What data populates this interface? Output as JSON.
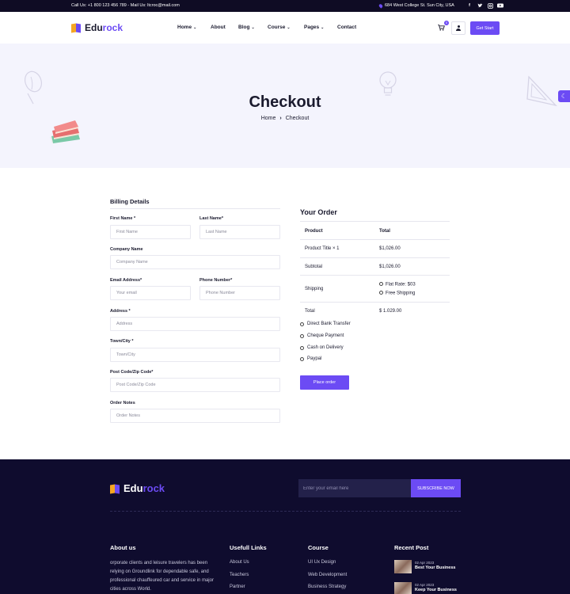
{
  "topbar": {
    "contact": "Call Us: +1 800 123 456 789 - Mail Us: ltcroc@mail.com",
    "address": "684 West College St. Sun City, USA",
    "socials": [
      "facebook-icon",
      "twitter-icon",
      "instagram-icon",
      "youtube-icon"
    ]
  },
  "header": {
    "logo_prefix": "Edu",
    "logo_suffix": "rock",
    "nav": [
      {
        "label": "Home",
        "dropdown": true
      },
      {
        "label": "About",
        "dropdown": false
      },
      {
        "label": "Blog",
        "dropdown": true
      },
      {
        "label": "Course",
        "dropdown": true
      },
      {
        "label": "Pages",
        "dropdown": true
      },
      {
        "label": "Contact",
        "dropdown": false
      }
    ],
    "cart_count": "0",
    "cta_label": "Get Start"
  },
  "hero": {
    "title": "Checkout",
    "breadcrumb_home": "Home",
    "breadcrumb_current": "Checkout"
  },
  "billing": {
    "title": "Billing Details",
    "first_name_label": "First Name *",
    "first_name_placeholder": "First Name",
    "last_name_label": "Last Name*",
    "last_name_placeholder": "Last Name",
    "company_label": "Company Name",
    "company_placeholder": "Company Name",
    "email_label": "Email Address*",
    "email_placeholder": "Your email",
    "phone_label": "Phone Number*",
    "phone_placeholder": "Phone Number",
    "address_label": "Address *",
    "address_placeholder": "Address",
    "town_label": "Town/City *",
    "town_placeholder": "Town/City",
    "post_label": "Post Code/Zip Code*",
    "post_placeholder": "Post Code/Zip Code",
    "notes_label": "Order Notes",
    "notes_placeholder": "Order Notes"
  },
  "order": {
    "title": "Your Order",
    "col_product": "Product",
    "col_total": "Total",
    "item_name": "Product Title × 1",
    "item_total": "$1,026.00",
    "subtotal_label": "Subtotal",
    "subtotal_value": "$1,026.00",
    "shipping_label": "Shipping",
    "shipping_options": [
      "Flat Rate: $03",
      "Free Shipping"
    ],
    "total_label": "Total",
    "total_value": "$ 1.029.00",
    "payment_methods": [
      "Direct Bank Transfer",
      "Cheque Payment",
      "Cash on Delivery",
      "Paypal"
    ],
    "place_order_label": "Place order"
  },
  "footer": {
    "logo_prefix": "Edu",
    "logo_suffix": "rock",
    "subscribe_placeholder": "Enter your email here",
    "subscribe_label": "SUBSCRIBE NOW",
    "about_title": "About us",
    "about_text": "orporate clients and leisure travelers has been relying on Groundlink for dependable safe, and professional chauffeured car and service in major cities across World.",
    "links_title": "Usefull Links",
    "links": [
      "About Us",
      "Teachers",
      "Partner"
    ],
    "course_title": "Course",
    "courses": [
      "UI Ux Design",
      "Web Development",
      "Business Strategy"
    ],
    "recent_title": "Recent Post",
    "posts": [
      {
        "date": "02 Apr 2023",
        "title": "Best Your Business"
      },
      {
        "date": "02 Apr 2023",
        "title": "Keep Your Business"
      }
    ]
  },
  "colors": {
    "accent": "#6c4bf4",
    "topbar_bg": "#0f0c24",
    "footer_bg": "#0f0c2e",
    "hero_bg": "#f4f4fd"
  }
}
